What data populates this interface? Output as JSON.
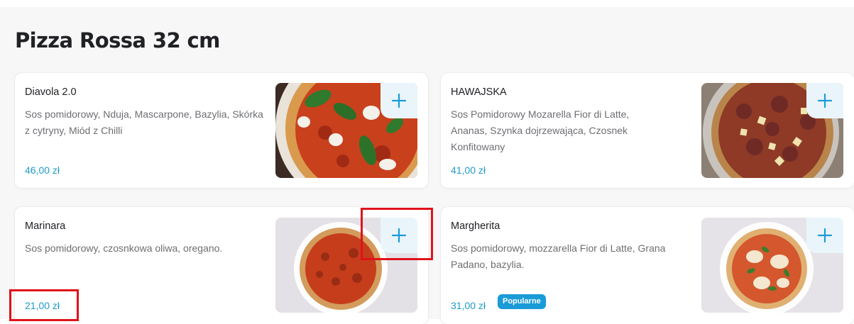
{
  "section": {
    "title": "Pizza Rossa 32 cm"
  },
  "items": [
    {
      "name": "Diavola 2.0",
      "description": "Sos pomidorowy, Nduja, Mascarpone, Bazylia, Skórka z cytryny, Miód z Chilli",
      "price": "46,00 zł"
    },
    {
      "name": "HAWAJSKA",
      "description": "Sos Pomidorowy Mozarella Fior di Latte, Ananas, Szynka dojrzewająca, Czosnek Konfitowany",
      "price": "41,00 zł"
    },
    {
      "name": "Marinara",
      "description": "Sos pomidorowy, czosnkowa oliwa, oregano.",
      "price": "21,00 zł"
    },
    {
      "name": "Margherita",
      "description": "Sos pomidorowy, mozzarella Fior di Latte, Grana Padano, bazylia.",
      "price": "31,00 zł",
      "badge": "Popularne"
    }
  ],
  "icons": {
    "add": "plus-icon"
  },
  "colors": {
    "accent": "#1f9bc4",
    "badge": "#1a9bd7",
    "add_button_bg": "#e9f5fa",
    "highlight": "#e0121b"
  }
}
